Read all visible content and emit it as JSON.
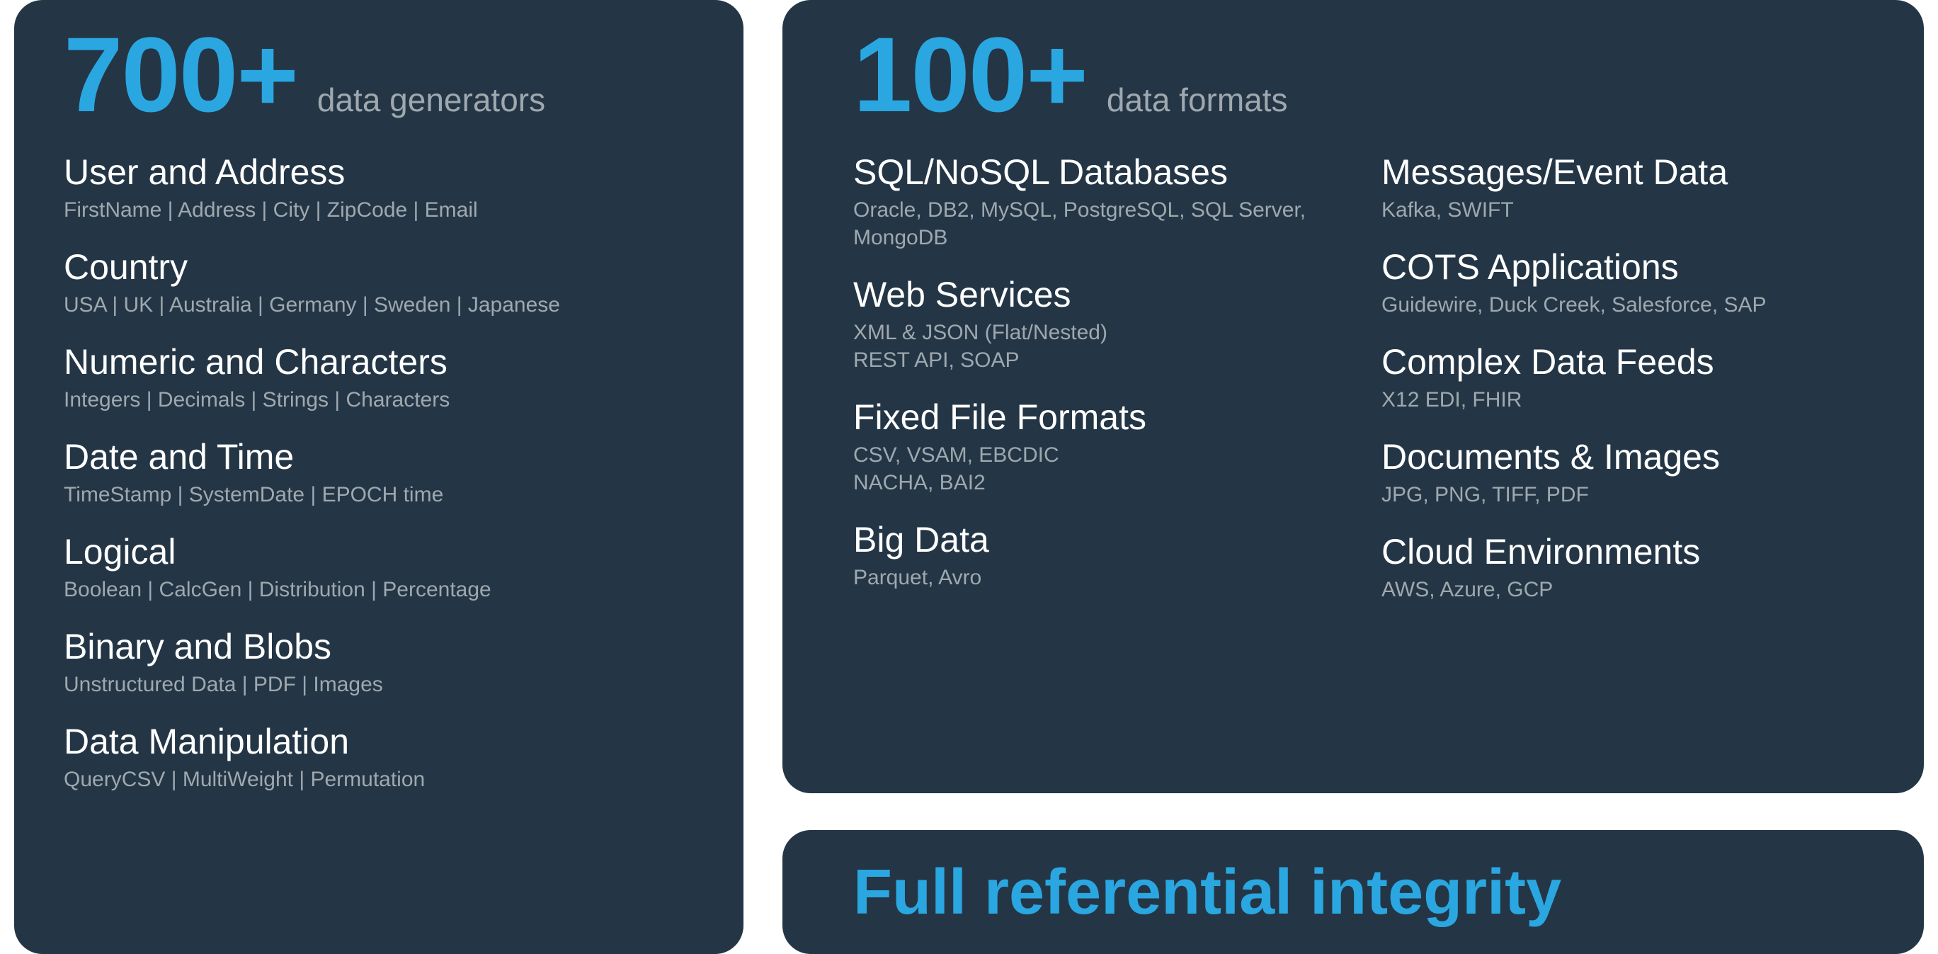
{
  "left": {
    "hero_number": "700+",
    "hero_label": "data generators",
    "categories": [
      {
        "title": "User and Address",
        "sub": "FirstName | Address |  City | ZipCode | Email"
      },
      {
        "title": "Country",
        "sub": "USA | UK | Australia | Germany | Sweden | Japanese"
      },
      {
        "title": "Numeric and Characters",
        "sub": "Integers | Decimals | Strings | Characters"
      },
      {
        "title": "Date and Time",
        "sub": "TimeStamp | SystemDate |  EPOCH time"
      },
      {
        "title": "Logical",
        "sub": "Boolean | CalcGen | Distribution | Percentage"
      },
      {
        "title": "Binary and Blobs",
        "sub": "Unstructured Data | PDF | Images"
      },
      {
        "title": "Data Manipulation",
        "sub": "QueryCSV | MultiWeight | Permutation"
      }
    ]
  },
  "right": {
    "hero_number": "100+",
    "hero_label": "data formats",
    "col1": [
      {
        "title": "SQL/NoSQL Databases",
        "sub": "Oracle, DB2, MySQL, PostgreSQL, SQL Server, MongoDB"
      },
      {
        "title": "Web Services",
        "sub": "XML & JSON (Flat/Nested)\nREST API, SOAP"
      },
      {
        "title": "Fixed File Formats",
        "sub": "CSV, VSAM, EBCDIC\nNACHA, BAI2"
      },
      {
        "title": "Big Data",
        "sub": "Parquet, Avro"
      }
    ],
    "col2": [
      {
        "title": "Messages/Event Data",
        "sub": "Kafka, SWIFT"
      },
      {
        "title": "COTS Applications",
        "sub": "Guidewire, Duck Creek, Salesforce, SAP"
      },
      {
        "title": "Complex Data Feeds",
        "sub": "X12 EDI, FHIR"
      },
      {
        "title": "Documents & Images",
        "sub": "JPG, PNG, TIFF, PDF"
      },
      {
        "title": "Cloud Environments",
        "sub": "AWS, Azure, GCP"
      }
    ]
  },
  "banner": {
    "text": "Full referential integrity"
  }
}
